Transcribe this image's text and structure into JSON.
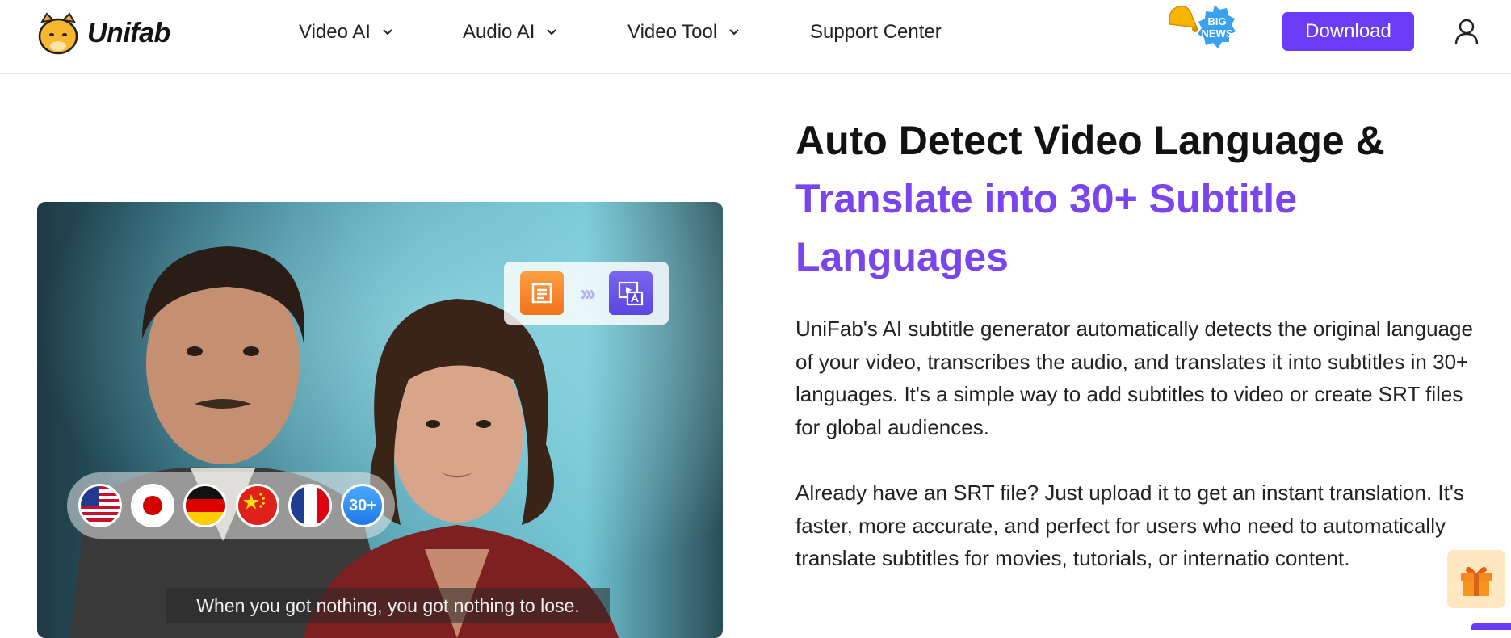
{
  "header": {
    "logo_text": "Unifab",
    "nav": [
      {
        "label": "Video AI",
        "has_dropdown": true
      },
      {
        "label": "Audio AI",
        "has_dropdown": true
      },
      {
        "label": "Video Tool",
        "has_dropdown": true
      },
      {
        "label": "Support Center",
        "has_dropdown": false
      }
    ],
    "big_news_label_1": "BIG",
    "big_news_label_2": "NEWS",
    "download_label": "Download",
    "accent_color": "#6b3cf5"
  },
  "hero": {
    "flags": [
      "US",
      "JP",
      "DE",
      "CN",
      "FR"
    ],
    "more_label": "30+",
    "caption": "When you got nothing, you got nothing to lose."
  },
  "content": {
    "headline_line1": "Auto Detect Video Language &",
    "headline_line2": "Translate into 30+ Subtitle",
    "headline_line3": "Languages",
    "headline_accent": "#7b45ee",
    "paragraph_1": "UniFab's AI subtitle generator automatically detects the original language of your video, transcribes the audio, and translates it into subtitles in 30+ languages. It's a simple way to add subtitles to video or create SRT files for global audiences.",
    "paragraph_2": "Already have an SRT file? Just upload it to get an instant translation. It's faster, more accurate, and perfect for users who need to automatically translate subtitles for movies, tutorials, or internatio content."
  },
  "icons": {
    "logo": "cat-logo-icon",
    "dropdown": "chevron-down-icon",
    "big_news": "bell-news-icon",
    "user": "user-icon",
    "gift": "gift-icon"
  }
}
